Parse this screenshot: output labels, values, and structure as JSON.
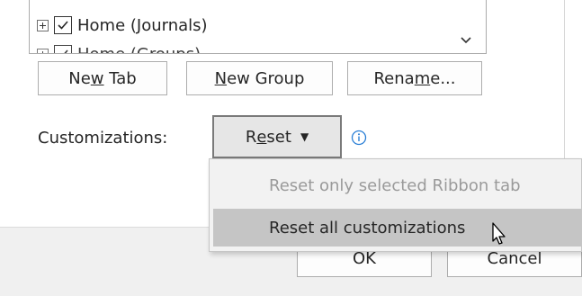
{
  "tree": {
    "items": [
      {
        "label": "Home (Journals)",
        "checked": true
      },
      {
        "label": "Home (Groups)",
        "checked": true
      }
    ]
  },
  "buttons": {
    "new_tab": {
      "pre": "Ne",
      "accel": "w",
      "post": " Tab"
    },
    "new_group": {
      "pre": "",
      "accel": "N",
      "post": "ew Group"
    },
    "rename": {
      "pre": "Rena",
      "accel": "m",
      "post": "e..."
    }
  },
  "customizations": {
    "label": "Customizations:",
    "reset": {
      "pre": "R",
      "accel": "e",
      "post": "set",
      "caret": "▼"
    }
  },
  "reset_menu": {
    "items": [
      {
        "label": "Reset only selected Ribbon tab",
        "enabled": false
      },
      {
        "label": "Reset all customizations",
        "enabled": true,
        "highlighted": true
      }
    ]
  },
  "footer": {
    "ok": "OK",
    "cancel": "Cancel"
  },
  "colors": {
    "accent_info": "#2a7fd6",
    "menu_highlight": "#c5c5c5",
    "disabled_text": "#9a9a9a"
  },
  "icons": [
    "expand-icon",
    "checkbox-checked-icon",
    "chevron-down-icon",
    "info-icon",
    "pointer-cursor-icon"
  ]
}
